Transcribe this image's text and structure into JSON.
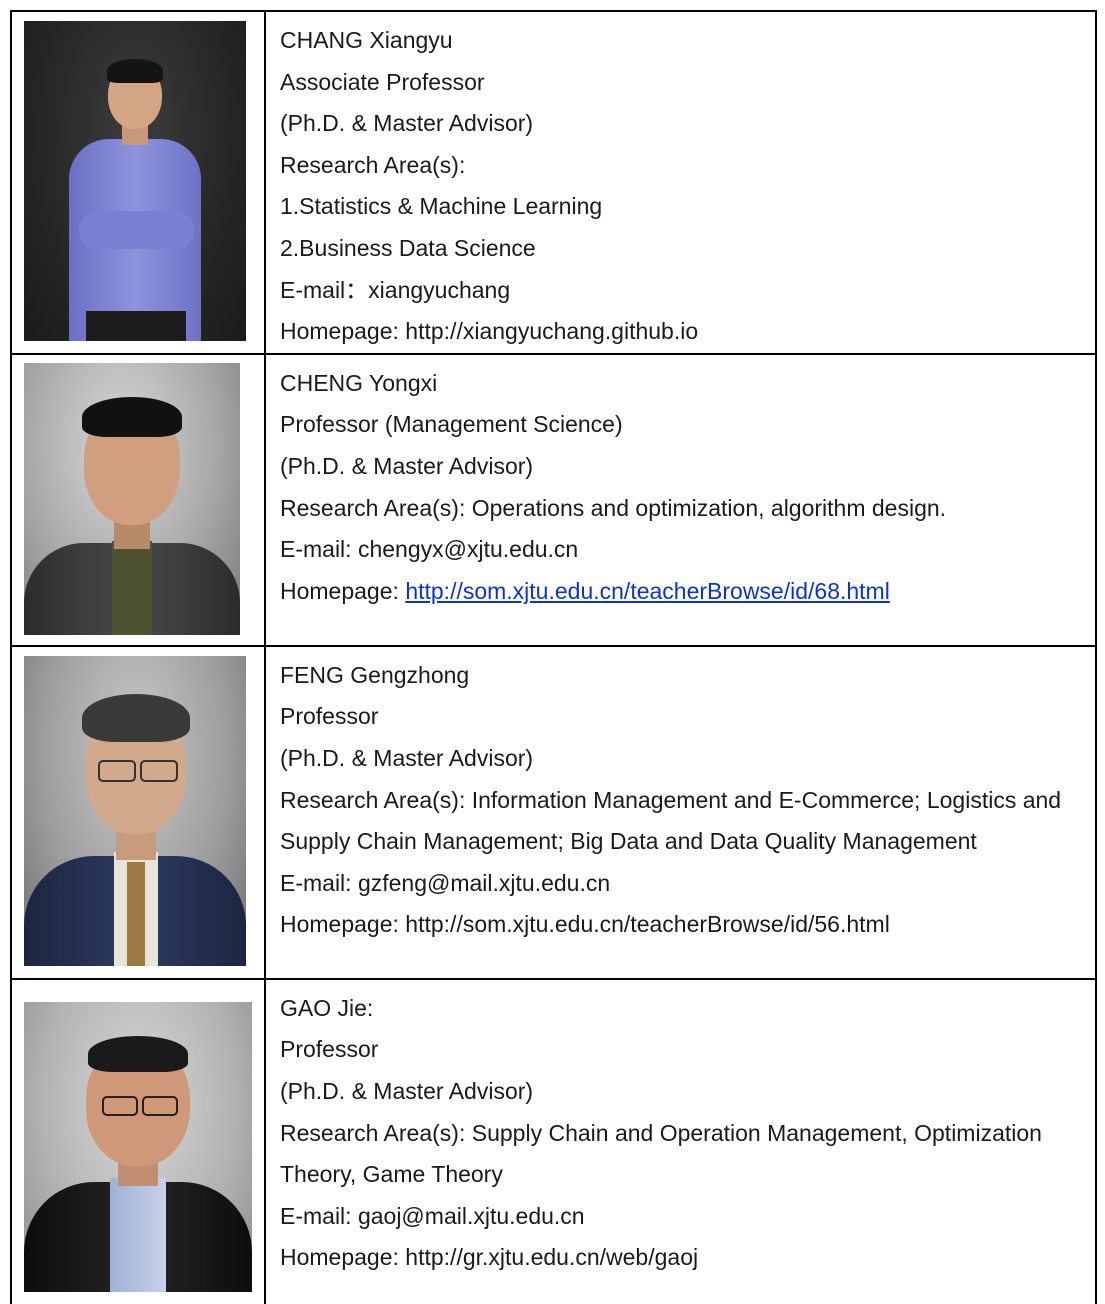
{
  "faculty": [
    {
      "lines": [
        "CHANG Xiangyu",
        "Associate Professor",
        "(Ph.D. & Master Advisor)",
        "Research Area(s):",
        "1.Statistics & Machine Learning",
        "2.Business Data Science",
        "E-mail：xiangyuchang",
        "Homepage: http://xiangyuchang.github.io"
      ]
    },
    {
      "lines": [
        "CHENG Yongxi",
        "Professor (Management Science)",
        "(Ph.D. & Master Advisor)",
        "Research Area(s): Operations and optimization, algorithm design.",
        "E-mail: chengyx@xjtu.edu.cn"
      ],
      "homepage_label": "Homepage: ",
      "homepage_link": "http://som.xjtu.edu.cn/teacherBrowse/id/68.html"
    },
    {
      "lines": [
        "FENG Gengzhong",
        "Professor",
        "(Ph.D. & Master Advisor)",
        "Research Area(s): Information Management and E-Commerce; Logistics and Supply Chain Management; Big Data and Data Quality Management",
        "E-mail: gzfeng@mail.xjtu.edu.cn",
        "Homepage: http://som.xjtu.edu.cn/teacherBrowse/id/56.html"
      ]
    },
    {
      "lines": [
        "GAO Jie:",
        "Professor",
        "(Ph.D. & Master Advisor)",
        "Research Area(s): Supply Chain and Operation Management, Optimization Theory, Game Theory",
        "E-mail: gaoj@mail.xjtu.edu.cn",
        "Homepage: http://gr.xjtu.edu.cn/web/gaoj"
      ]
    }
  ]
}
